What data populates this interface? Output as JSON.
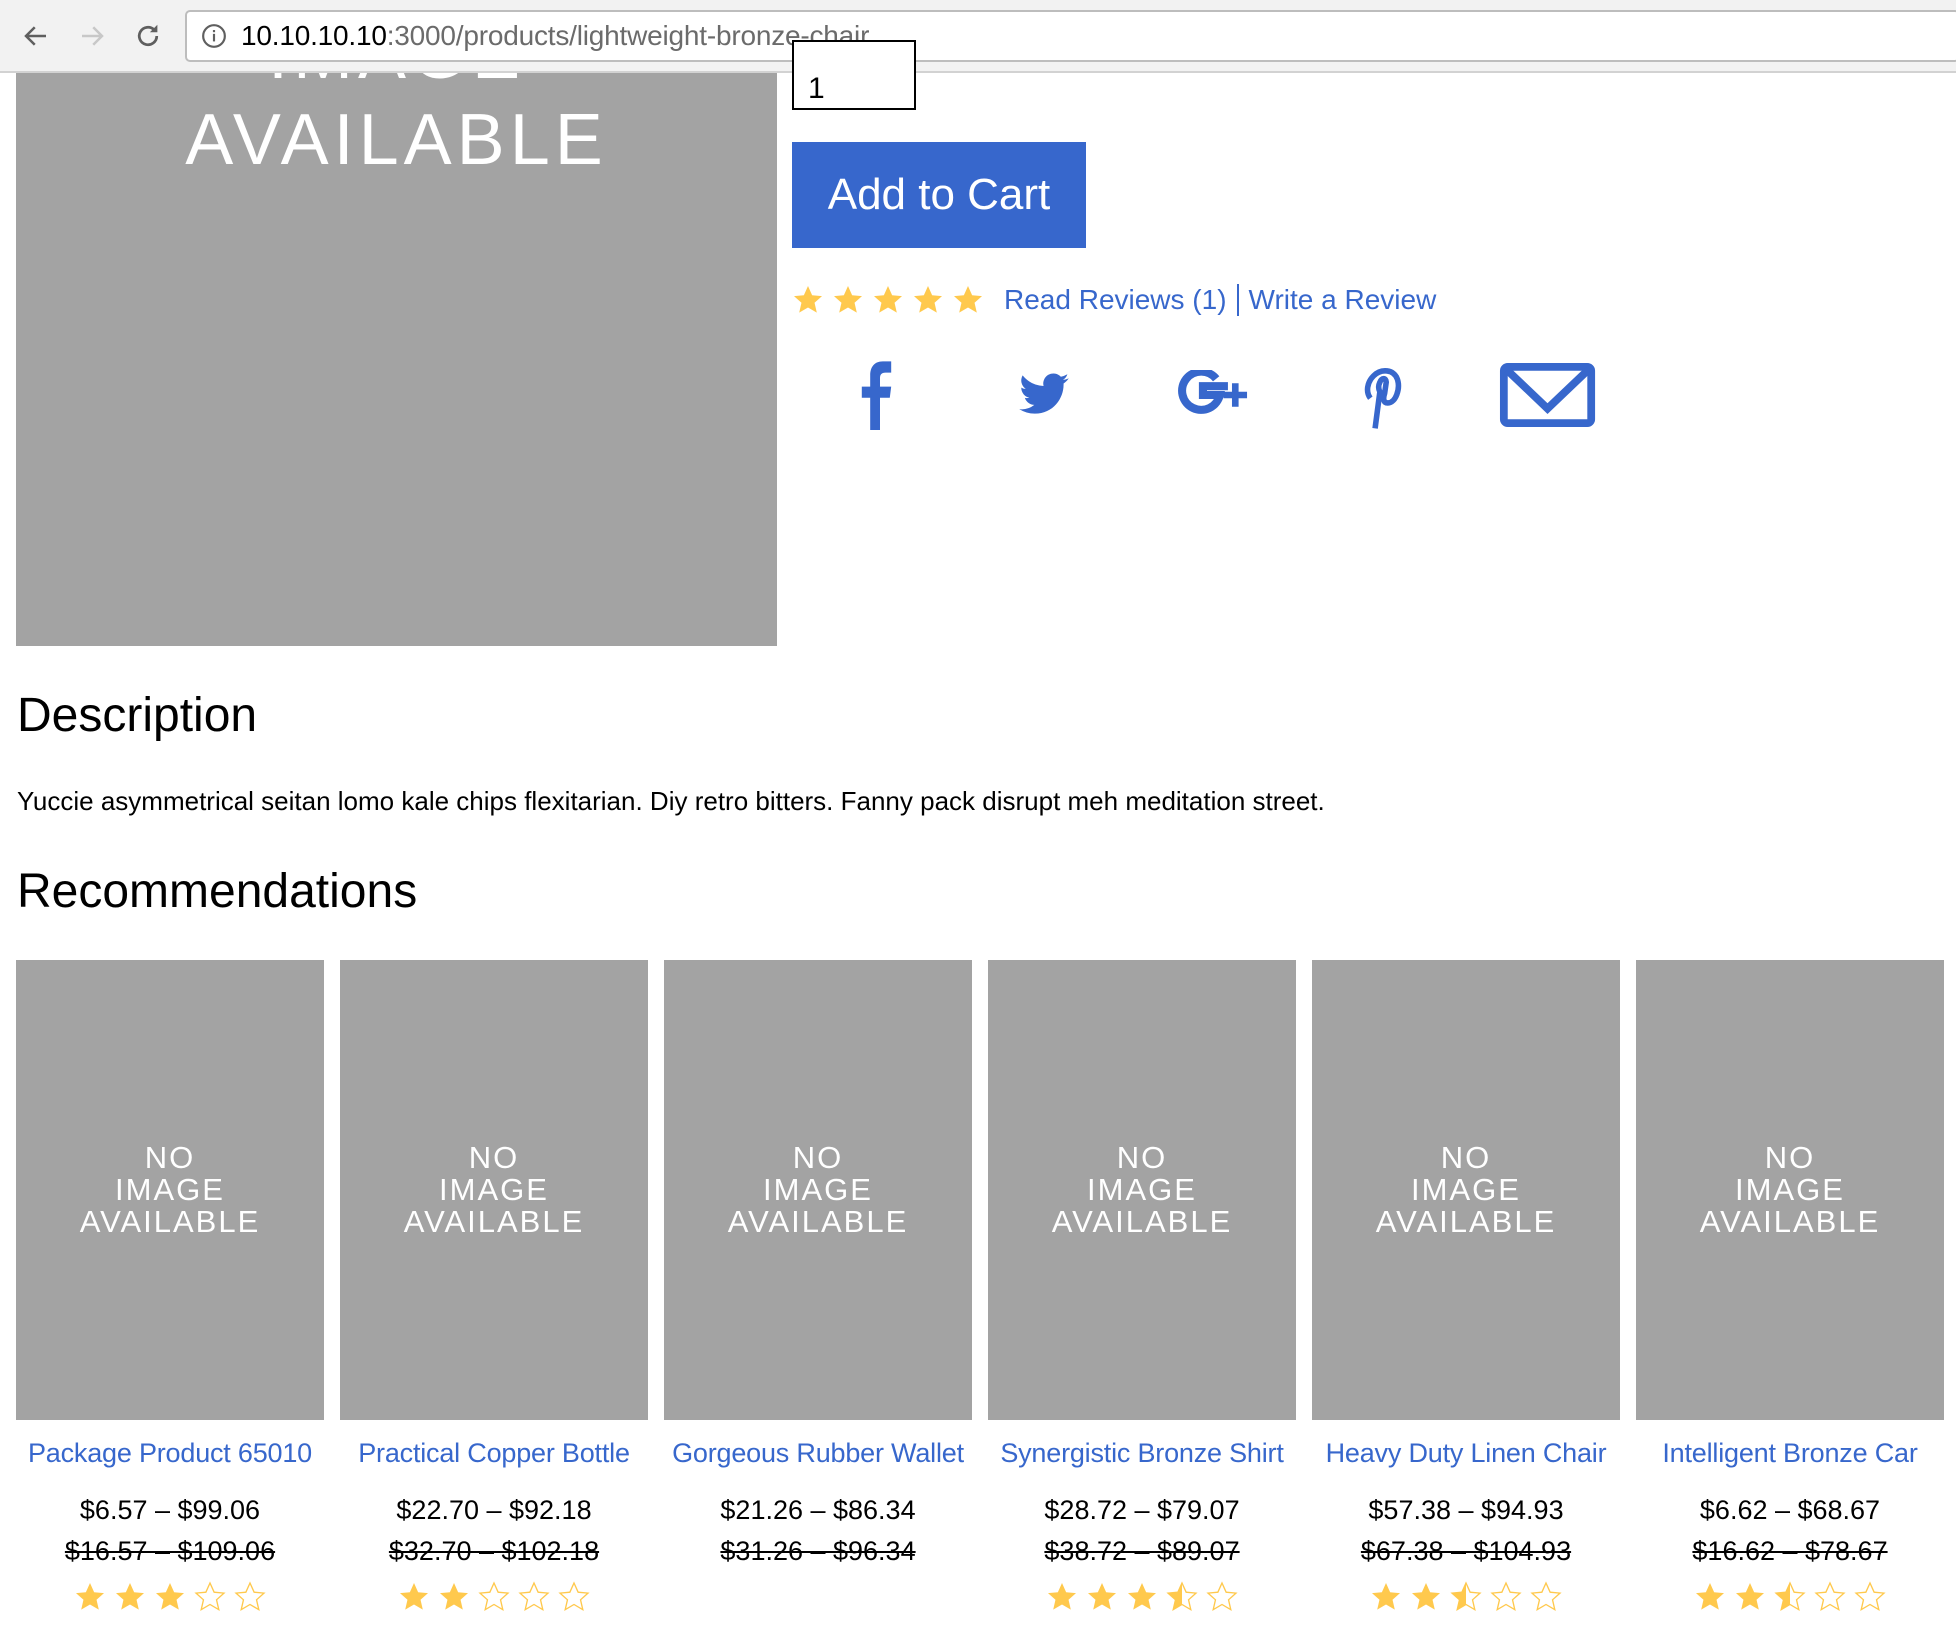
{
  "browser": {
    "url_host": "10.10.10.10",
    "url_path": ":3000/products/lightweight-bronze-chair"
  },
  "product": {
    "image_placeholder_lines": [
      "IMAGE",
      "AVAILABLE"
    ],
    "quantity": "1",
    "add_to_cart_label": "Add to Cart",
    "rating": 5,
    "rating_max": 5,
    "read_reviews_label": "Read Reviews (1)",
    "write_review_label": "Write a Review",
    "share": [
      "facebook",
      "twitter",
      "google-plus",
      "pinterest",
      "email"
    ]
  },
  "description": {
    "title": "Description",
    "text": "Yuccie asymmetrical seitan lomo kale chips flexitarian. Diy retro bitters. Fanny pack disrupt meh meditation street."
  },
  "recommendations": {
    "title": "Recommendations",
    "placeholder_lines": [
      "NO",
      "IMAGE",
      "AVAILABLE"
    ],
    "items": [
      {
        "name": "Package Product 65010",
        "price": "$6.57 – $99.06",
        "old_price": "$16.57 – $109.06",
        "rating": 3
      },
      {
        "name": "Practical Copper Bottle",
        "price": "$22.70 – $92.18",
        "old_price": "$32.70 – $102.18",
        "rating": 2
      },
      {
        "name": "Gorgeous Rubber Wallet",
        "price": "$21.26 – $86.34",
        "old_price": "$31.26 – $96.34",
        "rating": null
      },
      {
        "name": "Synergistic Bronze Shirt",
        "price": "$28.72 – $79.07",
        "old_price": "$38.72 – $89.07",
        "rating": 3.5
      },
      {
        "name": "Heavy Duty Linen Chair",
        "price": "$57.38 – $94.93",
        "old_price": "$67.38 – $104.93",
        "rating": 2.5
      },
      {
        "name": "Intelligent Bronze Car",
        "price": "$6.62 – $68.67",
        "old_price": "$16.62 – $78.67",
        "rating": 2.5
      }
    ]
  },
  "colors": {
    "accent": "#3767cc",
    "star": "#ffc94d",
    "placeholder_bg": "#a3a3a3"
  }
}
